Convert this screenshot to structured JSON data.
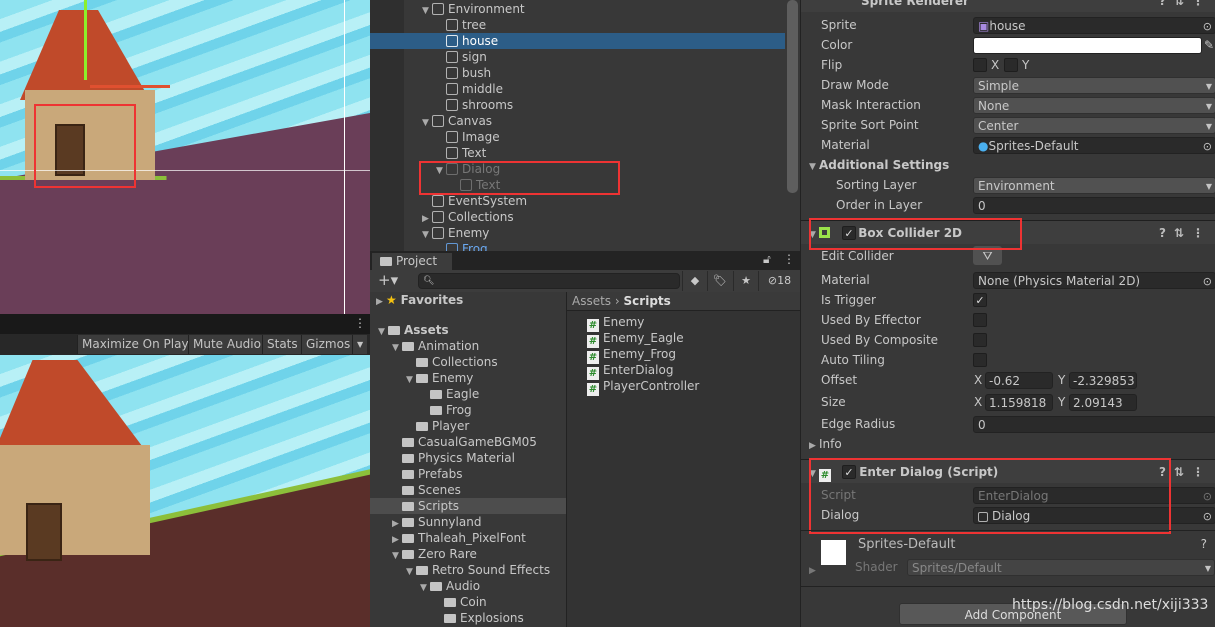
{
  "game_toolbar": {
    "maximize": "Maximize On Play",
    "mute": "Mute Audio",
    "stats": "Stats",
    "gizmos": "Gizmos"
  },
  "hierarchy": {
    "items": [
      {
        "label": "Environment",
        "depth": 0,
        "arrow": "▼"
      },
      {
        "label": "tree",
        "depth": 1
      },
      {
        "label": "house",
        "depth": 1,
        "selected": true
      },
      {
        "label": "sign",
        "depth": 1
      },
      {
        "label": "bush",
        "depth": 1
      },
      {
        "label": "middle",
        "depth": 1
      },
      {
        "label": "shrooms",
        "depth": 1
      },
      {
        "label": "Canvas",
        "depth": 0,
        "arrow": "▼"
      },
      {
        "label": "Image",
        "depth": 1
      },
      {
        "label": "Text",
        "depth": 1
      },
      {
        "label": "Dialog",
        "depth": 1,
        "arrow": "▼",
        "inactive": true
      },
      {
        "label": "Text",
        "depth": 2,
        "inactive": true
      },
      {
        "label": "EventSystem",
        "depth": 0
      },
      {
        "label": "Collections",
        "depth": 0,
        "arrow": "▶"
      },
      {
        "label": "Enemy",
        "depth": 0,
        "arrow": "▼"
      },
      {
        "label": "Frog",
        "depth": 1,
        "prefab": true
      }
    ]
  },
  "project": {
    "tab": "Project",
    "hidden_count": "18",
    "favorites": "Favorites",
    "tree": [
      {
        "label": "Assets",
        "depth": 0,
        "arrow": "▼"
      },
      {
        "label": "Animation",
        "depth": 1,
        "arrow": "▼"
      },
      {
        "label": "Collections",
        "depth": 2
      },
      {
        "label": "Enemy",
        "depth": 2,
        "arrow": "▼"
      },
      {
        "label": "Eagle",
        "depth": 3
      },
      {
        "label": "Frog",
        "depth": 3
      },
      {
        "label": "Player",
        "depth": 2
      },
      {
        "label": "CasualGameBGM05",
        "depth": 1
      },
      {
        "label": "Physics Material",
        "depth": 1
      },
      {
        "label": "Prefabs",
        "depth": 1
      },
      {
        "label": "Scenes",
        "depth": 1
      },
      {
        "label": "Scripts",
        "depth": 1,
        "selected": true
      },
      {
        "label": "Sunnyland",
        "depth": 1,
        "arrow": "▶"
      },
      {
        "label": "Thaleah_PixelFont",
        "depth": 1,
        "arrow": "▶"
      },
      {
        "label": "Zero Rare",
        "depth": 1,
        "arrow": "▼"
      },
      {
        "label": "Retro Sound Effects",
        "depth": 2,
        "arrow": "▼"
      },
      {
        "label": "Audio",
        "depth": 3,
        "arrow": "▼"
      },
      {
        "label": "Coin",
        "depth": 4
      },
      {
        "label": "Explosions",
        "depth": 4
      }
    ],
    "breadcrumb": {
      "root": "Assets",
      "current": "Scripts"
    },
    "files": [
      "Enemy",
      "Enemy_Eagle",
      "Enemy_Frog",
      "EnterDialog",
      "PlayerController"
    ]
  },
  "inspector": {
    "sprite_renderer": {
      "title": "Sprite Renderer",
      "sprite_label": "Sprite",
      "sprite": "house",
      "color_label": "Color",
      "color": "#ffffff",
      "flip_label": "Flip",
      "flip_x": "X",
      "flip_y": "Y",
      "draw_mode_label": "Draw Mode",
      "draw_mode": "Simple",
      "mask_label": "Mask Interaction",
      "mask": "None",
      "sort_point_label": "Sprite Sort Point",
      "sort_point": "Center",
      "material_label": "Material",
      "material": "Sprites-Default",
      "additional": "Additional Settings",
      "sorting_layer_label": "Sorting Layer",
      "sorting_layer": "Environment",
      "order_label": "Order in Layer",
      "order": "0"
    },
    "box_collider": {
      "title": "Box Collider 2D",
      "edit_label": "Edit Collider",
      "material_label": "Material",
      "material": "None (Physics Material 2D)",
      "trigger_label": "Is Trigger",
      "effector_label": "Used By Effector",
      "composite_label": "Used By Composite",
      "tiling_label": "Auto Tiling",
      "offset_label": "Offset",
      "offset_x": "-0.62",
      "offset_y": "-2.329853",
      "size_label": "Size",
      "size_x": "1.159818",
      "size_y": "2.09143",
      "x": "X",
      "y": "Y",
      "radius_label": "Edge Radius",
      "radius": "0",
      "info": "Info"
    },
    "enter_dialog": {
      "title": "Enter Dialog (Script)",
      "script_label": "Script",
      "script": "EnterDialog",
      "dialog_label": "Dialog",
      "dialog": "Dialog"
    },
    "material": {
      "name": "Sprites-Default",
      "shader_label": "Shader",
      "shader": "Sprites/Default"
    },
    "add_component": "Add Component"
  },
  "watermark": "https://blog.csdn.net/xiji333",
  "colors": {
    "selection": "#2c5d87",
    "highlight_box": "#ee3333",
    "panel": "#383838"
  }
}
